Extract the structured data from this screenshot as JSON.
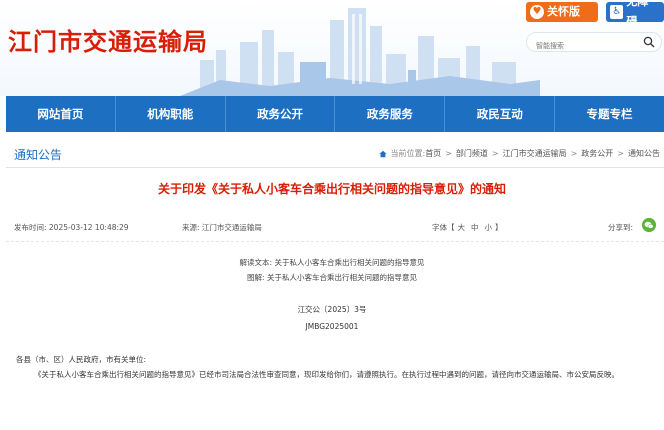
{
  "header": {
    "site_title": "江门市交通运输局",
    "care_button": "关怀版",
    "access_button": "无障碍",
    "search_placeholder": "智能搜索"
  },
  "nav": {
    "items": [
      "网站首页",
      "机构职能",
      "政务公开",
      "政务服务",
      "政民互动",
      "专题专栏"
    ]
  },
  "breadcrumb": {
    "section_title": "通知公告",
    "prefix": "当前位置:",
    "items": [
      "首页",
      "部门频道",
      "江门市交通运输局",
      "政务公开",
      "通知公告"
    ]
  },
  "article": {
    "title": "关于印发《关于私人小客车合乘出行相关问题的指导意见》的通知",
    "publish_time": "发布时间:  2025-03-12 10:48:29",
    "source": "来源:  江门市交通运输局",
    "font_label": "字体【",
    "font_sizes": [
      "大",
      "中",
      "小"
    ],
    "font_close": "】",
    "share_label": "分享到:",
    "related_interpret": "解读文本:  关于私人小客车合乘出行相关问题的指导意见",
    "related_graphic": "图解:  关于私人小客车合乘出行相关问题的指导意见",
    "doc_number": "江交公〔2025〕3号",
    "doc_code": "JMBG2025001",
    "salutation": "各县（市、区）人民政府，市有关单位:",
    "paragraph": "《关于私人小客车合乘出行相关问题的指导意见》已经市司法局合法性审查同意，现印发给你们，请遵照执行。在执行过程中遇到的问题，请径向市交通运输局、市公安局反映。"
  },
  "colors": {
    "brand_red": "#d81e06",
    "nav_blue": "#1d6fc2",
    "care_orange": "#ef6c1a",
    "access_blue": "#2a71c9",
    "wechat_green": "#5bb53a"
  }
}
